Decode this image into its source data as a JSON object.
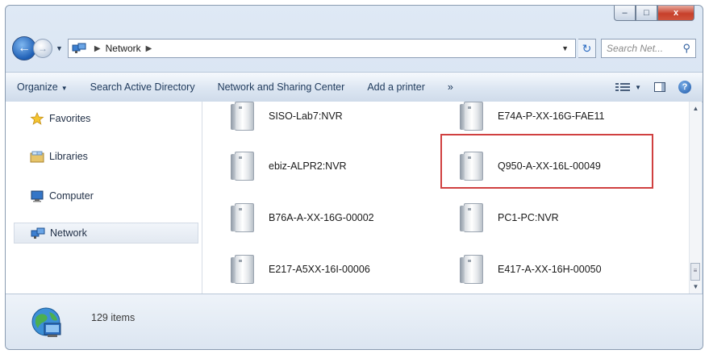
{
  "window": {
    "caption": {
      "minimize": "–",
      "maximize": "□",
      "close": "x"
    }
  },
  "address": {
    "path": "Network",
    "search_placeholder": "Search Net..."
  },
  "toolbar": {
    "organize": "Organize",
    "search_ad": "Search Active Directory",
    "network_center": "Network and Sharing Center",
    "add_printer": "Add a printer",
    "more": "»"
  },
  "navigation": {
    "favorites": "Favorites",
    "libraries": "Libraries",
    "computer": "Computer",
    "network": "Network"
  },
  "devices": [
    {
      "name": "SISO-Lab7:NVR"
    },
    {
      "name": "E74A-P-XX-16G-FAE11"
    },
    {
      "name": "ebiz-ALPR2:NVR"
    },
    {
      "name": "Q950-A-XX-16L-00049"
    },
    {
      "name": "B76A-A-XX-16G-00002"
    },
    {
      "name": "PC1-PC:NVR"
    },
    {
      "name": "E217-A5XX-16I-00006"
    },
    {
      "name": "E417-A-XX-16H-00050"
    }
  ],
  "highlighted_device": "Q950-A-XX-16L-00049",
  "status": {
    "item_count": "129 items"
  },
  "colors": {
    "highlight_border": "#d04040",
    "accent": "#1e5fb5"
  },
  "icons": {
    "back": "back-arrow-icon",
    "forward": "forward-arrow-icon",
    "refresh": "refresh-icon",
    "search": "magnifier-icon",
    "device": "network-device-icon",
    "globe": "network-globe-icon"
  }
}
